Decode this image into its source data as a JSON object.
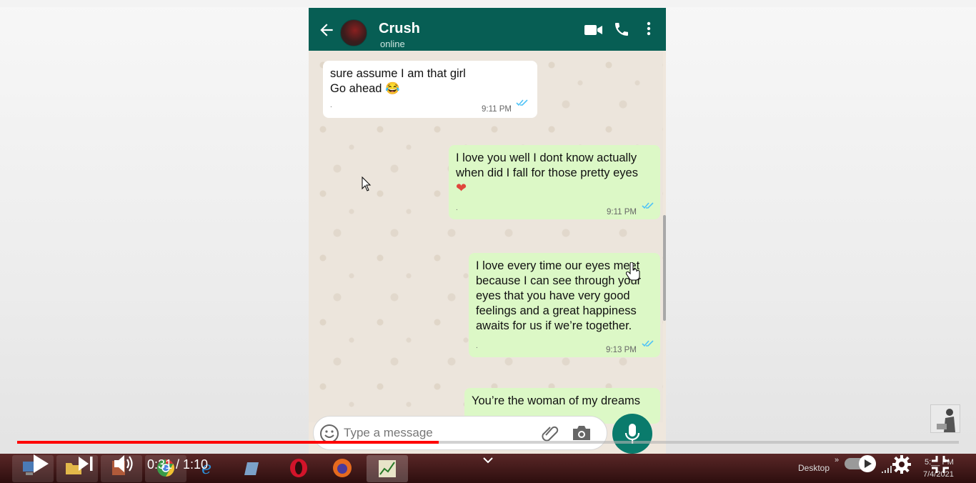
{
  "chat": {
    "contact_name": "Crush",
    "status": "online",
    "messages": [
      {
        "dir": "in",
        "lines": [
          "sure assume I am that girl",
          "Go ahead 😂"
        ],
        "dot": ".",
        "time": "9:11 PM"
      },
      {
        "dir": "out",
        "lines": [
          "I love you well I dont know actually",
          "when did I fall for those pretty eyes"
        ],
        "emoji": "❤",
        "dot": ".",
        "time": "9:11 PM"
      },
      {
        "dir": "out",
        "lines": [
          "I love every time our eyes meet",
          "because I can see through your",
          "eyes that you have very good",
          "feelings and a great happiness",
          "awaits for us if we’re together."
        ],
        "dot": ".",
        "time": "9:13 PM"
      },
      {
        "dir": "out",
        "lines": [
          "You’re the woman of my dreams"
        ]
      }
    ],
    "input_placeholder": "Type a message"
  },
  "player": {
    "current_time": "0:31",
    "duration": "1:10",
    "time_display": "0:31 / 1:10",
    "progress": 0.448,
    "autoplay_on": true
  },
  "taskbar": {
    "desktop_label": "Desktop",
    "clock_time": "5:__ PM",
    "clock_date": "7/4/2021"
  },
  "colors": {
    "header": "#075e54",
    "outgoing_bubble": "#dcf8c6",
    "incoming_bubble": "#ffffff",
    "progress": "#ff0000",
    "tick": "#4fc3f7"
  }
}
